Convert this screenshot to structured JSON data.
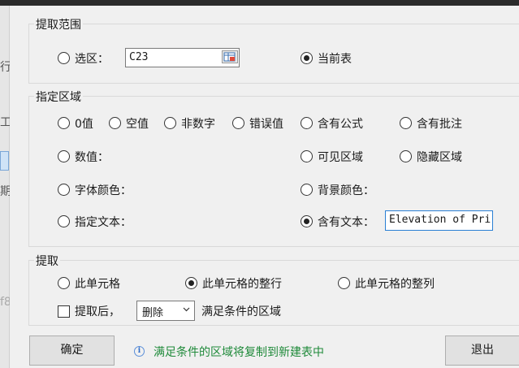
{
  "background": {
    "glyph_1": "行",
    "glyph_2": "工",
    "glyph_3": "期",
    "glyph_4": "f8"
  },
  "extract_range": {
    "legend": "提取范围",
    "selection_label": "选区：",
    "selection_value": "C23",
    "current_sheet_label": "当前表",
    "selected": "current_sheet"
  },
  "specified_area": {
    "legend": "指定区域",
    "options": {
      "zero": "0值",
      "blank": "空值",
      "non_numeric": "非数字",
      "error": "错误值",
      "has_formula": "含有公式",
      "has_comment": "含有批注",
      "number": "数值：",
      "visible": "可见区域",
      "hidden": "隐藏区域",
      "font_color": "字体颜色：",
      "bg_color": "背景颜色：",
      "specified_text": "指定文本：",
      "contains_text": "含有文本："
    },
    "contains_text_value": "Elevation of Pri",
    "selected": "contains_text"
  },
  "extract": {
    "legend": "提取",
    "this_cell": "此单元格",
    "entire_row": "此单元格的整行",
    "entire_column": "此单元格的整列",
    "selected": "entire_row",
    "after_extract_label": "提取后，",
    "after_extract_checked": false,
    "action_value": "删除",
    "suffix": "满足条件的区域"
  },
  "footer": {
    "ok_label": "确定",
    "exit_label": "退出",
    "info_icon": "info-icon",
    "info_text": "满足条件的区域将复制到新建表中"
  }
}
